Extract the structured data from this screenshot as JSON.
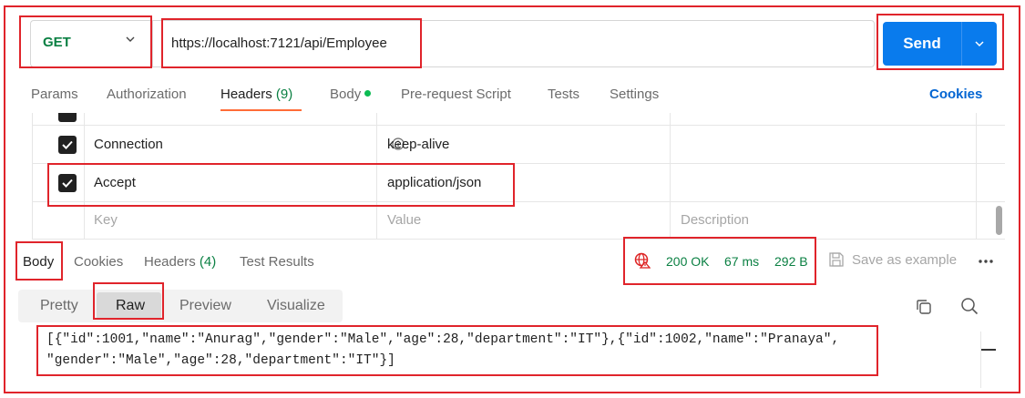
{
  "request": {
    "method": "GET",
    "url": "https://localhost:7121/api/Employee",
    "send_label": "Send"
  },
  "request_tabs": {
    "params": "Params",
    "authorization": "Authorization",
    "headers": "Headers",
    "headers_count": "(9)",
    "body": "Body",
    "pre_request": "Pre-request Script",
    "tests": "Tests",
    "settings": "Settings",
    "cookies": "Cookies"
  },
  "headers_table": {
    "rows": [
      {
        "key": "Connection",
        "value": "keep-alive",
        "checked": true
      },
      {
        "key": "Accept",
        "value": "application/json",
        "checked": true
      }
    ],
    "placeholder_key": "Key",
    "placeholder_value": "Value",
    "placeholder_description": "Description"
  },
  "response_tabs": {
    "body": "Body",
    "cookies": "Cookies",
    "headers": "Headers",
    "headers_count": "(4)",
    "test_results": "Test Results"
  },
  "response_status": {
    "status": "200 OK",
    "time": "67 ms",
    "size": "292 B",
    "save_example": "Save as example"
  },
  "format_tabs": {
    "pretty": "Pretty",
    "raw": "Raw",
    "preview": "Preview",
    "visualize": "Visualize"
  },
  "response_body": {
    "line1": "[{\"id\":1001,\"name\":\"Anurag\",\"gender\":\"Male\",\"age\":28,\"department\":\"IT\"},{\"id\":1002,\"name\":\"Pranaya\",",
    "line2": "\"gender\":\"Male\",\"age\":28,\"department\":\"IT\"}]"
  },
  "colors": {
    "accent_blue": "#097bed",
    "method_green": "#0b8043",
    "highlight_red": "#e0242b",
    "tab_underline": "#ff6c37"
  },
  "icons": {
    "method_dropdown": "chevron-down-icon",
    "send_dropdown": "chevron-down-icon",
    "info": "info-icon",
    "checkbox": "checkbox-checked-icon",
    "globe": "globe-warning-icon",
    "save": "save-icon",
    "more": "more-horizontal-icon",
    "copy": "copy-icon",
    "search": "search-icon"
  }
}
